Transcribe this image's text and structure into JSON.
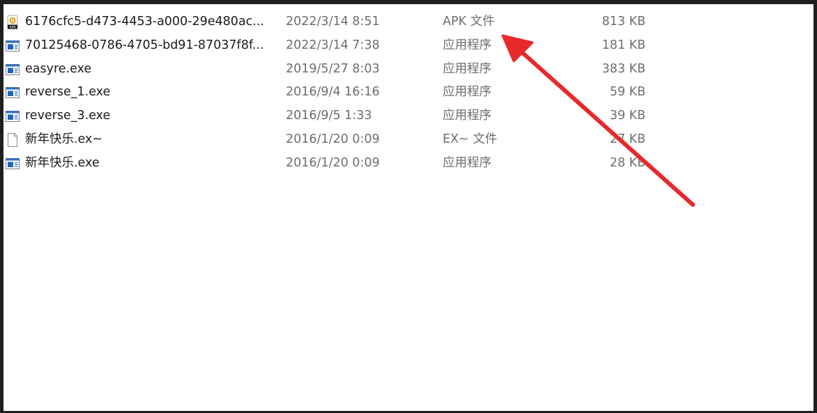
{
  "colors": {
    "annotation_arrow": "#e8282b",
    "window_border": "#1f1f1f",
    "name_text": "#1b1b1b",
    "meta_text": "#6e6e6e"
  },
  "files": [
    {
      "icon": "apk-file-icon",
      "name": "6176cfc5-d473-4453-a000-29e480ac...",
      "date": "2022/3/14 8:51",
      "type": "APK 文件",
      "size": "813 KB"
    },
    {
      "icon": "exe-app-icon",
      "name": "70125468-0786-4705-bd91-87037f8f...",
      "date": "2022/3/14 7:38",
      "type": "应用程序",
      "size": "181 KB"
    },
    {
      "icon": "exe-app-icon",
      "name": "easyre.exe",
      "date": "2019/5/27 8:03",
      "type": "应用程序",
      "size": "383 KB"
    },
    {
      "icon": "exe-app-icon",
      "name": "reverse_1.exe",
      "date": "2016/9/4 16:16",
      "type": "应用程序",
      "size": "59 KB"
    },
    {
      "icon": "exe-app-icon",
      "name": "reverse_3.exe",
      "date": "2016/9/5 1:33",
      "type": "应用程序",
      "size": "39 KB"
    },
    {
      "icon": "blank-file-icon",
      "name": "新年快乐.ex~",
      "date": "2016/1/20 0:09",
      "type": "EX~ 文件",
      "size": "27 KB"
    },
    {
      "icon": "exe-app-icon",
      "name": "新年快乐.exe",
      "date": "2016/1/20 0:09",
      "type": "应用程序",
      "size": "28 KB"
    }
  ]
}
